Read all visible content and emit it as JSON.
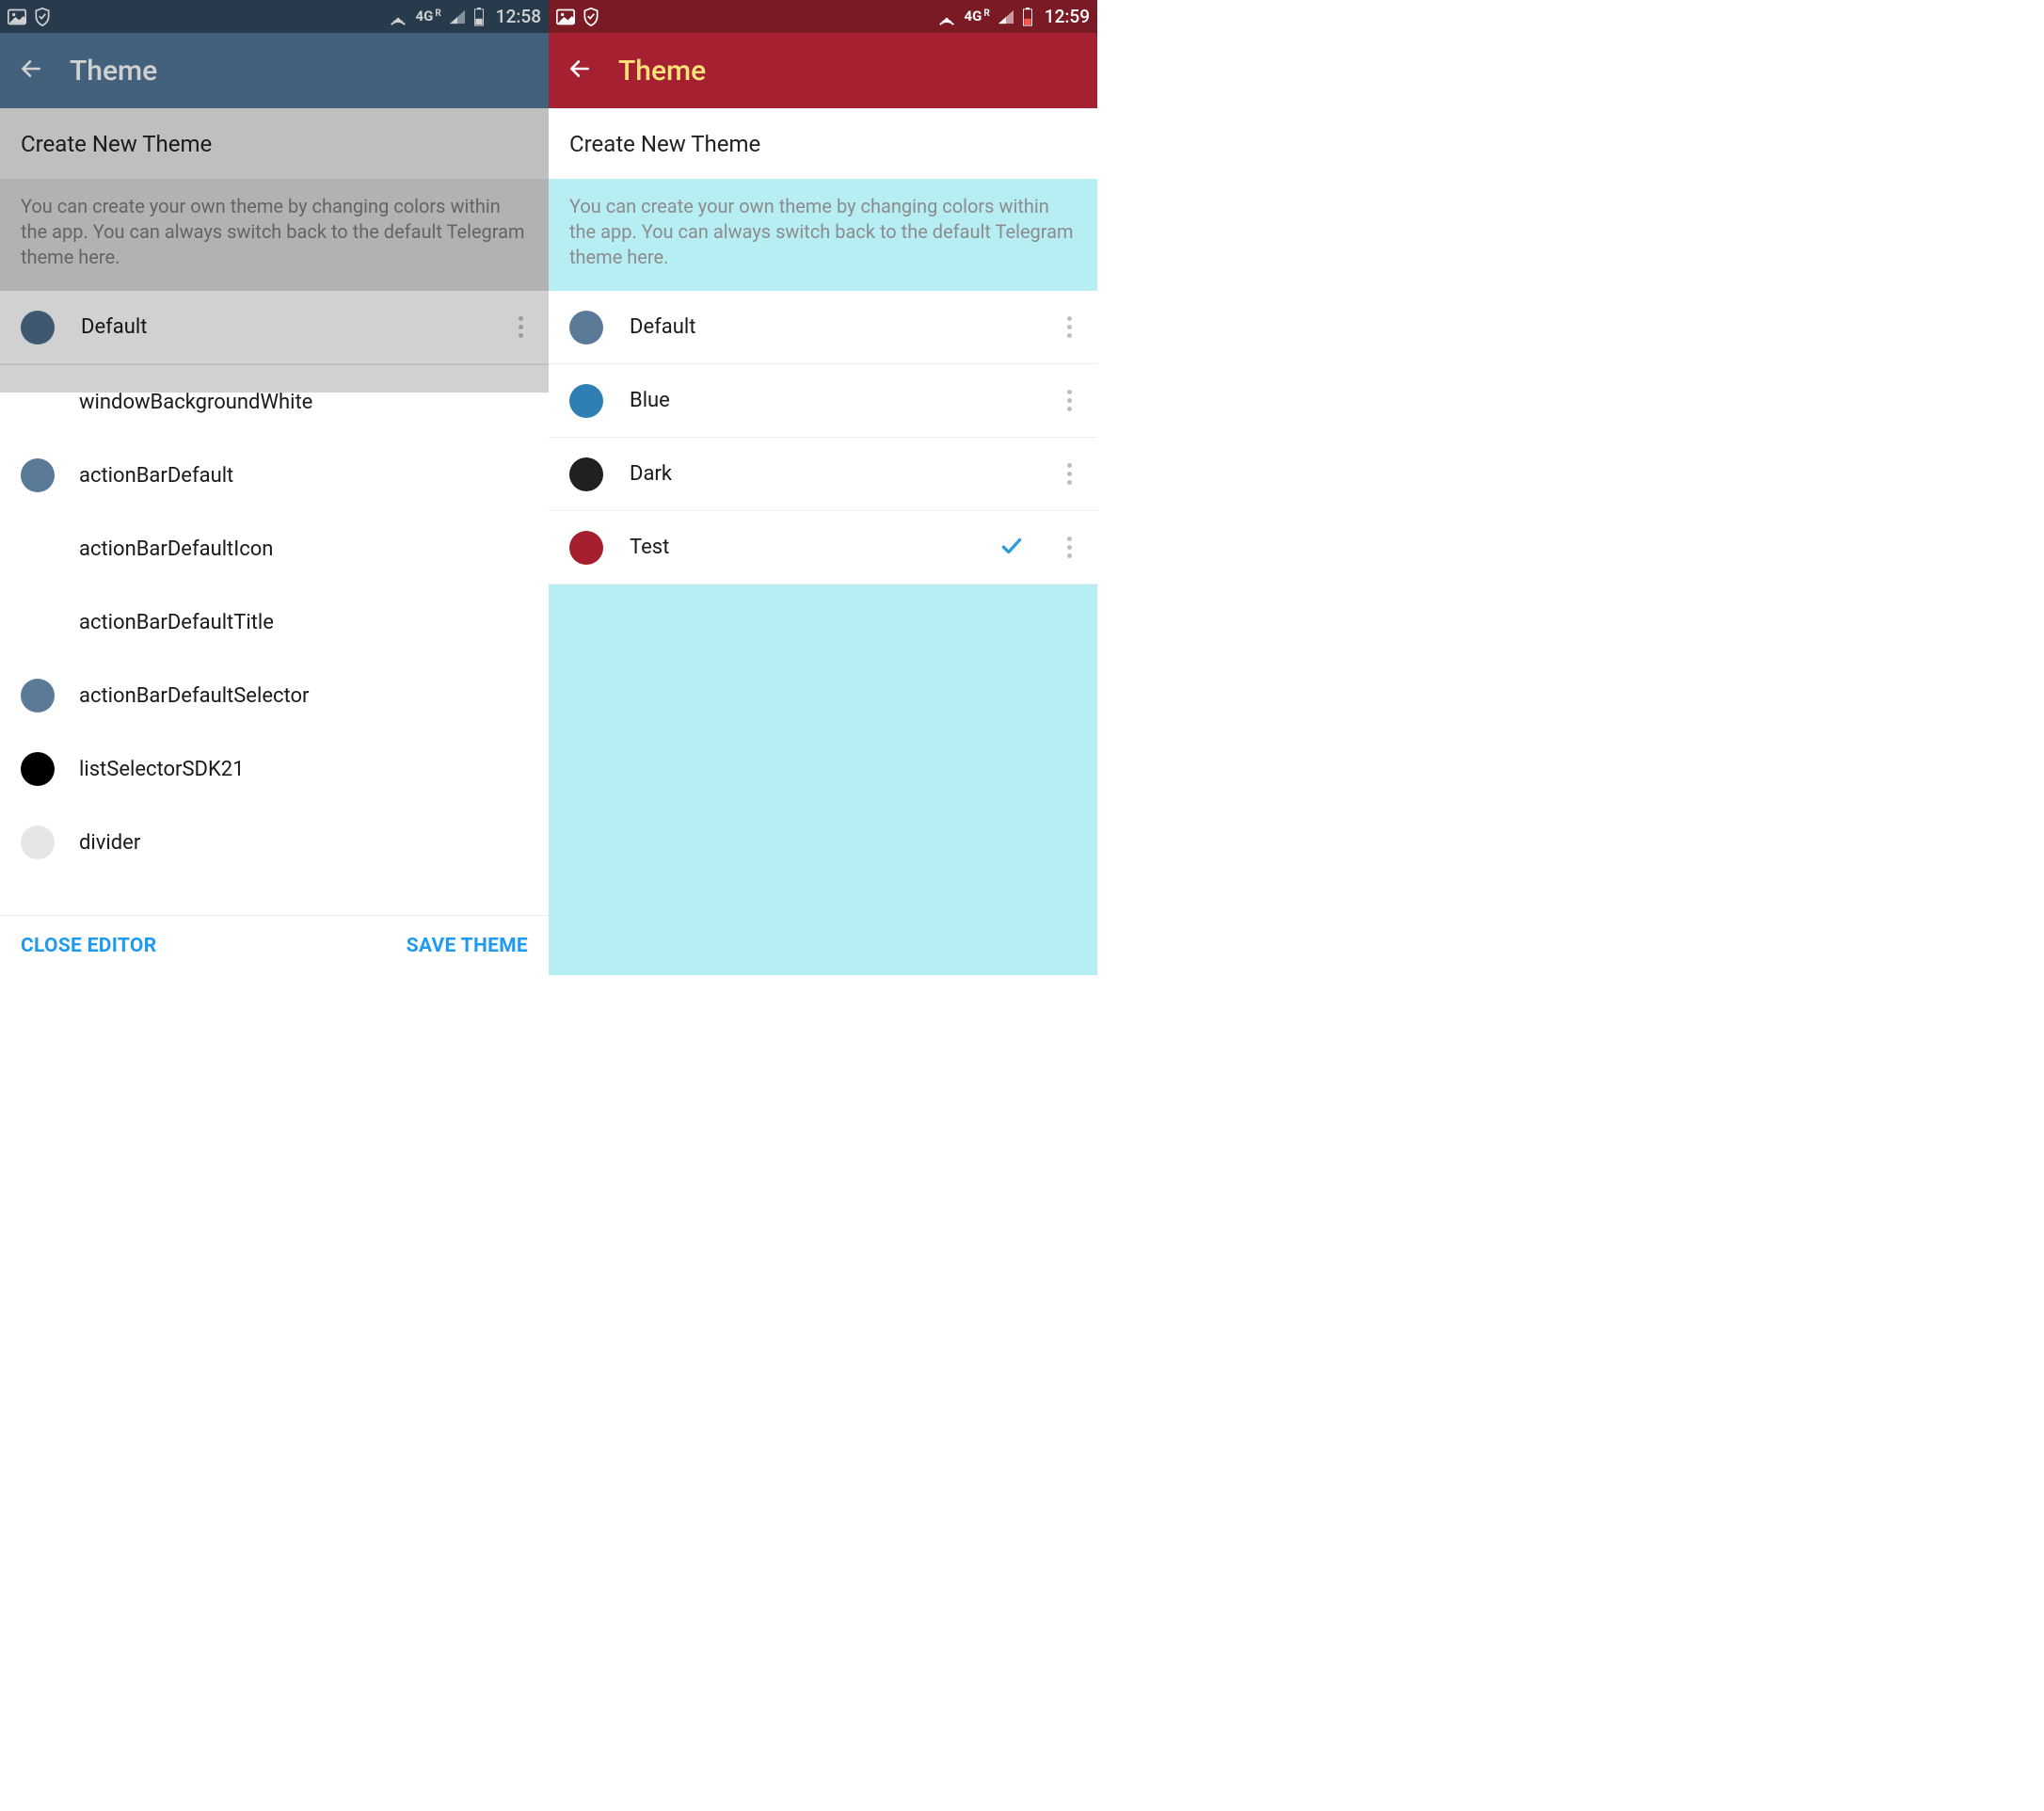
{
  "left": {
    "status": {
      "time": "12:58",
      "net": "4G",
      "roam": "R"
    },
    "appbar": {
      "title": "Theme"
    },
    "create_label": "Create New Theme",
    "description": "You can create your own theme by changing colors within the app. You can always switch back to the default Telegram theme here.",
    "themes": [
      {
        "name": "Default",
        "color": "#4d6b88"
      }
    ],
    "editor_items": [
      {
        "name": "windowBackgroundWhite",
        "color": ""
      },
      {
        "name": "actionBarDefault",
        "color": "#5a7a97"
      },
      {
        "name": "actionBarDefaultIcon",
        "color": ""
      },
      {
        "name": "actionBarDefaultTitle",
        "color": ""
      },
      {
        "name": "actionBarDefaultSelector",
        "color": "#5a7a97"
      },
      {
        "name": "listSelectorSDK21",
        "color": "#000000"
      },
      {
        "name": "divider",
        "color": "#e6e6e6"
      }
    ],
    "bottom": {
      "close": "CLOSE EDITOR",
      "save": "SAVE THEME"
    }
  },
  "right": {
    "status": {
      "time": "12:59",
      "net": "4G",
      "roam": "R"
    },
    "appbar": {
      "title": "Theme"
    },
    "create_label": "Create New Theme",
    "description": "You can create your own theme by changing colors within the app. You can always switch back to the default Telegram theme here.",
    "themes": [
      {
        "name": "Default",
        "color": "#5a7a97",
        "selected": false
      },
      {
        "name": "Blue",
        "color": "#2f7fb5",
        "selected": false
      },
      {
        "name": "Dark",
        "color": "#1f2022",
        "selected": false
      },
      {
        "name": "Test",
        "color": "#a51f2f",
        "selected": true
      }
    ]
  }
}
